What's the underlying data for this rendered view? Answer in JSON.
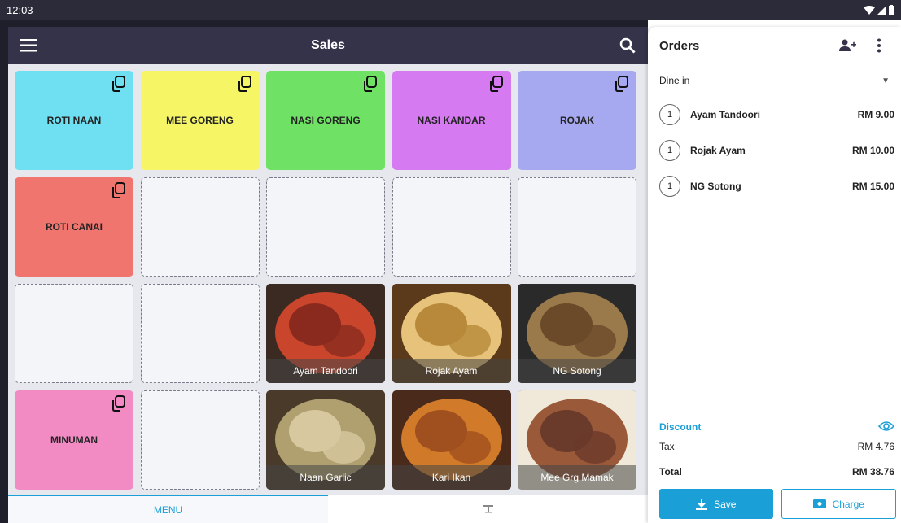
{
  "status_bar": {
    "time": "12:03"
  },
  "header": {
    "title": "Sales"
  },
  "tiles": [
    {
      "kind": "category",
      "label": "ROTI NAAN",
      "color": "#6fe0f2"
    },
    {
      "kind": "category",
      "label": "MEE GORENG",
      "color": "#f5f566"
    },
    {
      "kind": "category",
      "label": "NASI GORENG",
      "color": "#6fe266"
    },
    {
      "kind": "category",
      "label": "NASI KANDAR",
      "color": "#d67af2"
    },
    {
      "kind": "category",
      "label": "ROJAK",
      "color": "#a7a9f0"
    },
    {
      "kind": "category",
      "label": "ROTI CANAI",
      "color": "#f0756f"
    },
    {
      "kind": "empty"
    },
    {
      "kind": "empty"
    },
    {
      "kind": "empty"
    },
    {
      "kind": "empty"
    },
    {
      "kind": "empty"
    },
    {
      "kind": "empty"
    },
    {
      "kind": "product",
      "label": "Ayam Tandoori"
    },
    {
      "kind": "product",
      "label": "Rojak Ayam"
    },
    {
      "kind": "product",
      "label": "NG Sotong"
    },
    {
      "kind": "category",
      "label": "MINUMAN",
      "color": "#f28ac4"
    },
    {
      "kind": "empty"
    },
    {
      "kind": "product",
      "label": "Naan Garlic"
    },
    {
      "kind": "product",
      "label": "Kari Ikan"
    },
    {
      "kind": "product",
      "label": "Mee Grg Mamak"
    }
  ],
  "bottom_nav": {
    "menu_label": "MENU"
  },
  "orders": {
    "title": "Orders",
    "order_type": "Dine in",
    "items": [
      {
        "qty": "1",
        "name": "Ayam Tandoori",
        "price": "RM 9.00"
      },
      {
        "qty": "1",
        "name": "Rojak Ayam",
        "price": "RM 10.00"
      },
      {
        "qty": "1",
        "name": "NG Sotong",
        "price": "RM 15.00"
      }
    ],
    "discount_label": "Discount",
    "tax_label": "Tax",
    "tax_value": "RM 4.76",
    "total_label": "Total",
    "total_value": "RM 38.76",
    "save_label": "Save",
    "charge_label": "Charge"
  },
  "colors": {
    "accent": "#1a9fd6",
    "appbar": "#34334a"
  }
}
